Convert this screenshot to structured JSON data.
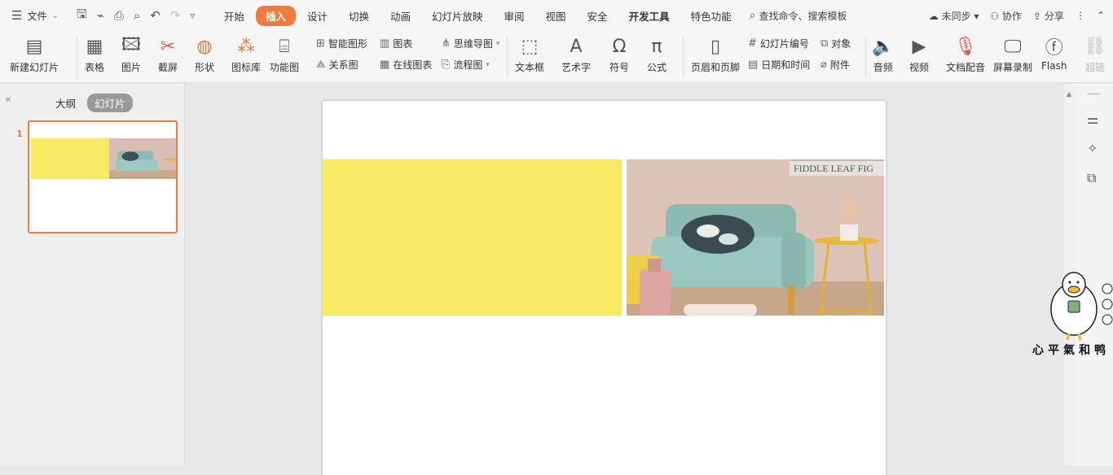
{
  "menubar": {
    "file_label": "文件",
    "tabs": [
      "开始",
      "插入",
      "设计",
      "切换",
      "动画",
      "幻灯片放映",
      "审阅",
      "视图",
      "安全",
      "开发工具",
      "特色功能"
    ],
    "active_tab": "插入",
    "search_label": "查找命令、搜索模板",
    "sync_label": "未同步",
    "collab_label": "协作",
    "share_label": "分享"
  },
  "toolbar": {
    "new_slide": "新建幻灯片",
    "table": "表格",
    "picture": "图片",
    "screenshot": "截屏",
    "shape": "形状",
    "icon_lib": "图标库",
    "func_chart": "功能图",
    "smart_art": "智能图形",
    "chart": "图表",
    "relation": "关系图",
    "online_chart": "在线图表",
    "mindmap": "思维导图",
    "flowchart": "流程图",
    "textbox": "文本框",
    "wordart": "艺术字",
    "symbol": "符号",
    "formula": "公式",
    "header_footer": "页眉和页脚",
    "slide_number": "幻灯片编号",
    "object": "对象",
    "date_time": "日期和时间",
    "attachment": "附件",
    "audio": "音频",
    "video": "视频",
    "doc_voice": "文档配音",
    "screen_record": "屏幕录制",
    "flash": "Flash",
    "hyperlink": "超链"
  },
  "sidebar": {
    "outline_label": "大纲",
    "slides_label": "幻灯片",
    "slide_number": "1"
  },
  "slide": {
    "poster_text": "FIDDLE LEAF FIG"
  },
  "sticker": {
    "caption": "心平氣和鸭"
  },
  "colors": {
    "accent": "#f07c3c",
    "yellow_block": "#f8e864"
  }
}
